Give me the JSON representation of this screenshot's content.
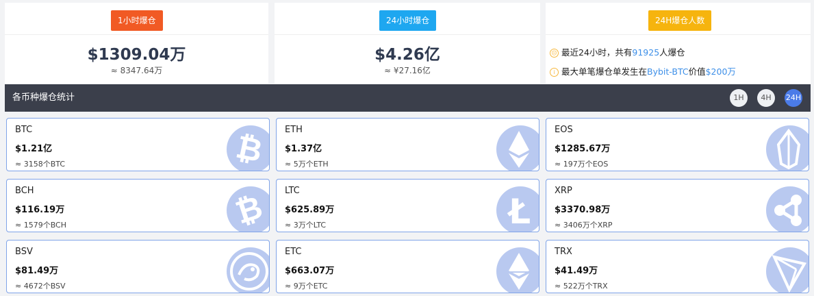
{
  "summary": {
    "hour": {
      "tag": "1小时爆仓",
      "value": "$1309.04万",
      "approx": "≈ 8347.64万",
      "tag_color": "#f15a24"
    },
    "day": {
      "tag": "24小时爆仓",
      "value": "$4.26亿",
      "approx": "≈ ¥27.16亿",
      "tag_color": "#1ea7f0"
    },
    "people": {
      "tag": "24H爆仓人数",
      "tag_color": "#f6b40e",
      "line1_prefix": "最近24小时，共有",
      "line1_count": "91925",
      "line1_suffix": "人爆仓",
      "line2_prefix": "最大单笔爆仓单发生在",
      "line2_exchange": "Bybit-BTC",
      "line2_mid": "价值",
      "line2_value": "$200万"
    }
  },
  "stats": {
    "title": "各币种爆仓统计",
    "tabs": [
      {
        "label": "1H"
      },
      {
        "label": "4H"
      },
      {
        "label": "24H"
      }
    ],
    "active_tab": "24H"
  },
  "coins": [
    {
      "name": "BTC",
      "usd": "$1.21亿",
      "amount": "≈ 3158个BTC",
      "icon": "bitcoin-icon"
    },
    {
      "name": "ETH",
      "usd": "$1.37亿",
      "amount": "≈ 5万个ETH",
      "icon": "ethereum-icon"
    },
    {
      "name": "EOS",
      "usd": "$1285.67万",
      "amount": "≈ 197万个EOS",
      "icon": "eos-icon"
    },
    {
      "name": "BCH",
      "usd": "$116.19万",
      "amount": "≈ 1579个BCH",
      "icon": "bitcoin-cash-icon"
    },
    {
      "name": "LTC",
      "usd": "$625.89万",
      "amount": "≈ 3万个LTC",
      "icon": "litecoin-icon"
    },
    {
      "name": "XRP",
      "usd": "$3370.98万",
      "amount": "≈ 3406万个XRP",
      "icon": "ripple-icon"
    },
    {
      "name": "BSV",
      "usd": "$81.49万",
      "amount": "≈ 4672个BSV",
      "icon": "bsv-dragon-icon"
    },
    {
      "name": "ETC",
      "usd": "$663.07万",
      "amount": "≈ 9万个ETC",
      "icon": "ethereum-classic-icon"
    },
    {
      "name": "TRX",
      "usd": "$41.49万",
      "amount": "≈ 522万个TRX",
      "icon": "tron-icon"
    }
  ]
}
